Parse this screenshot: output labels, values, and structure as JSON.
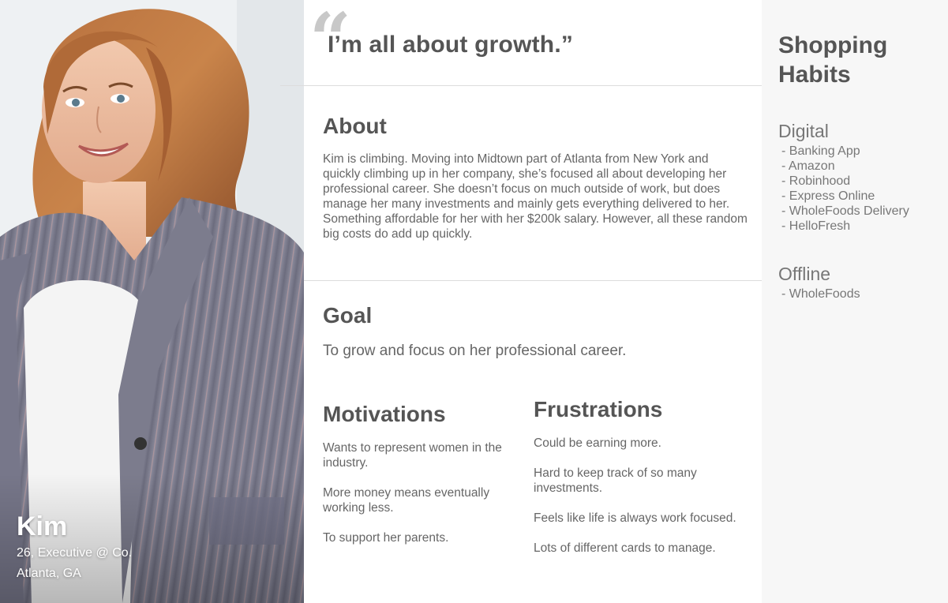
{
  "persona": {
    "name": "Kim",
    "role": "26, Executive @ Co.",
    "location": "Atlanta, GA"
  },
  "quote": {
    "mark": "“",
    "text": "I’m all about growth.”"
  },
  "about": {
    "title": "About",
    "body": "Kim is climbing. Moving into Midtown part of Atlanta from New York and quickly climbing up in her company, she’s focused all about developing her professional career. She doesn’t focus on much outside of work, but does manage her many investments and mainly gets everything delivered to her. Something affordable for her with her $200k salary. However, all these random big costs do add up quickly."
  },
  "goal": {
    "title": "Goal",
    "body": "To grow and focus on her professional career."
  },
  "motivations": {
    "title": "Motivations",
    "items": [
      "Wants to represent women in the industry.",
      "More money means eventually working less.",
      "To support her parents."
    ]
  },
  "frustrations": {
    "title": "Frustrations",
    "items": [
      "Could be earning more.",
      "Hard to keep track of so many investments.",
      "Feels like life is always work focused.",
      "Lots of different cards to manage."
    ]
  },
  "shopping": {
    "title": "Shopping Habits",
    "digital": {
      "title": "Digital",
      "items": [
        "- Banking App",
        "- Amazon",
        "- Robinhood",
        "- Express Online",
        "- WholeFoods Delivery",
        "- HelloFresh"
      ]
    },
    "offline": {
      "title": "Offline",
      "items": [
        "- WholeFoods"
      ]
    }
  },
  "colors": {
    "text": "#555555",
    "muted": "#666666",
    "sidebar_bg": "#f7f7f7",
    "divider": "#dddddd",
    "quote_mark": "#c8c8c8"
  }
}
